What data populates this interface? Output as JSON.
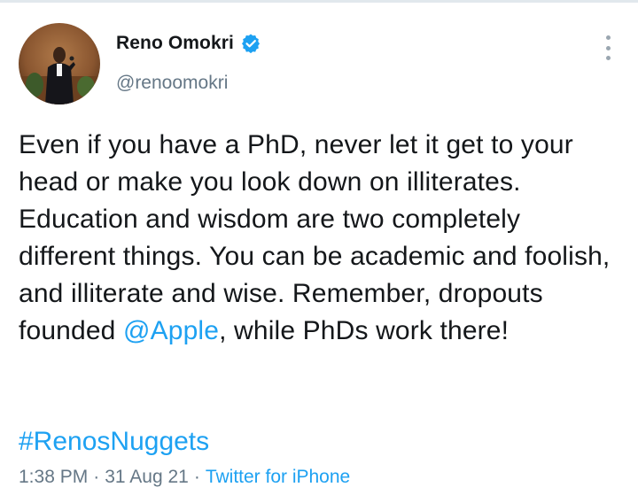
{
  "tweet": {
    "author": {
      "name": "Reno Omokri",
      "handle": "@renoomokri",
      "avatar": "speaker-photo",
      "verified_icon": "verified-badge-icon"
    },
    "text": {
      "line1": "Even if you have a PhD, never let it get to your head or make you look down on illiterates. Education and wisdom are two completely different things. You can be academic and foolish, and illiterate and wise. Remember, dropouts founded ",
      "mention": "@Apple",
      "line2": ", while PhDs work there!"
    },
    "hashtag": "#RenosNuggets",
    "time": "1:38 PM",
    "date": "31 Aug 21",
    "separator": "·",
    "source": "Twitter for iPhone",
    "more_icon": "more-vertical-icon"
  },
  "colors": {
    "accent": "#1da1f2",
    "text": "#14171a",
    "muted": "#657786"
  }
}
